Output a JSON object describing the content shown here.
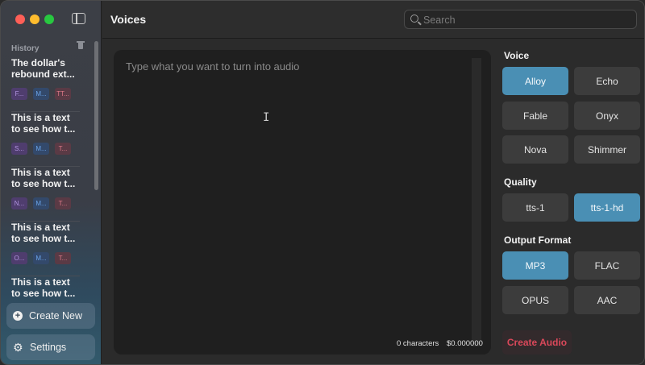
{
  "sidebar": {
    "history_title": "History",
    "items": [
      {
        "title": "The dollar's rebound ext...",
        "tags": [
          "F...",
          "M...",
          "TT..."
        ]
      },
      {
        "title": "This is a text to see how t...",
        "tags": [
          "S...",
          "M...",
          "T..."
        ]
      },
      {
        "title": "This is a text to see how t...",
        "tags": [
          "N...",
          "M...",
          "T..."
        ]
      },
      {
        "title": "This is a text to see how t...",
        "tags": [
          "O...",
          "M...",
          "T..."
        ]
      },
      {
        "title": "This is a text to see how t...",
        "tags": []
      }
    ],
    "create_new_label": "Create New",
    "settings_label": "Settings"
  },
  "header": {
    "title": "Voices",
    "search_placeholder": "Search"
  },
  "editor": {
    "placeholder": "Type what you want to turn into audio",
    "char_count": "0 characters",
    "cost": "$0.000000"
  },
  "panel": {
    "voice_title": "Voice",
    "voices": [
      "Alloy",
      "Echo",
      "Fable",
      "Onyx",
      "Nova",
      "Shimmer"
    ],
    "selected_voice": "Alloy",
    "quality_title": "Quality",
    "qualities": [
      "tts-1",
      "tts-1-hd"
    ],
    "selected_quality": "tts-1-hd",
    "format_title": "Output Format",
    "formats": [
      "MP3",
      "FLAC",
      "OPUS",
      "AAC"
    ],
    "selected_format": "MP3",
    "create_audio_label": "Create Audio"
  },
  "colors": {
    "accent": "#4a8fb4",
    "danger": "#d9485a"
  }
}
